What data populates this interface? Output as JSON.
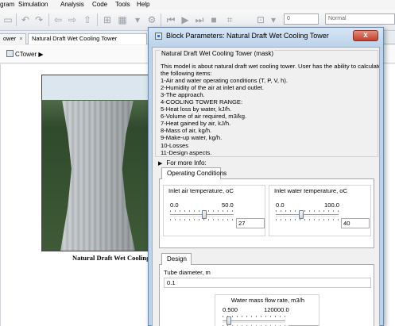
{
  "menubar": {
    "items": [
      "gram",
      "Simulation",
      "Analysis",
      "Code",
      "Tools",
      "Help"
    ]
  },
  "toolbar": {
    "icons": [
      "save-icon",
      "undo-icon",
      "redo-icon",
      "back-icon",
      "forward-icon",
      "up-icon",
      "library-icon",
      "model-explorer-icon",
      "step-back-icon",
      "run-icon",
      "step-forward-icon",
      "stop-icon",
      "scope-icon"
    ],
    "stop_time": "0",
    "sim_mode": "Normal"
  },
  "tabs": [
    {
      "label": "ower"
    },
    {
      "label": "Natural Draft Wet Cooling Tower"
    }
  ],
  "address": {
    "model": "CTower"
  },
  "canvas": {
    "caption": "Natural Draft Wet Cooling"
  },
  "dialog": {
    "title": "Block Parameters: Natural Draft Wet Cooling Tower",
    "close_glyph": "x",
    "mask_title": "Natural Draft Wet Cooling Tower (mask)",
    "description": [
      "This model is about natural draft wet cooling tower. User has the ability to calculate",
      "the following items:",
      "1-Air and water operating conditions (T, P, V, h).",
      "2-Humidity of the air at inlet and outlet.",
      "3-The approach.",
      "4-COOLING TOWER RANGE:",
      "5-Heat loss by water, kJ/h.",
      "6-Volume of air required, m3/kg.",
      "7-Heat gained by air, kJ/h.",
      "8-Mass of air, kg/h.",
      "9-Make-up water, kg/h.",
      "10-Losses",
      "11-Design aspects."
    ],
    "more_info": "For more Info:",
    "operating_tab": "Operating Conditions",
    "inlet_air": {
      "label": "Inlet air temperature, oC",
      "min": "0.0",
      "max": "50.0",
      "value": "27",
      "fraction": 0.54
    },
    "inlet_water": {
      "label": "Inlet water temperature, oC",
      "min": "0.0",
      "max": "100.0",
      "value": "40",
      "fraction": 0.4
    },
    "design_tab": "Design",
    "tube": {
      "label": "Tube diameter, m",
      "value": "0.1"
    },
    "water_mass": {
      "label": "Water mass flow rate, m3/h",
      "min": "0.500",
      "max": "120000.0",
      "value": "12000",
      "fraction": 0.1
    }
  }
}
